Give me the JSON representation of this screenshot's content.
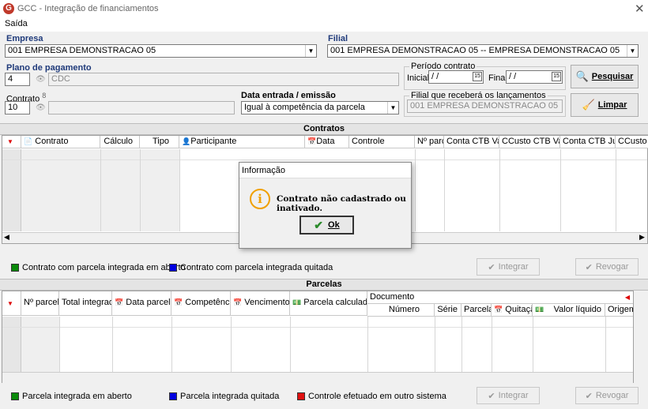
{
  "window": {
    "title": "GCC - Integração de financiamentos",
    "close_glyph": "✕",
    "logo_letter": "G"
  },
  "menu": {
    "items": [
      "Saída"
    ]
  },
  "empresa": {
    "label": "Empresa",
    "value": "001 EMPRESA DEMONSTRACAO 05"
  },
  "filial": {
    "label": "Filial",
    "value": "001 EMPRESA DEMONSTRACAO 05 -- EMPRESA DEMONSTRACAO 05"
  },
  "plano": {
    "label": "Plano de pagamento",
    "code": "4",
    "desc": "CDC"
  },
  "contrato": {
    "label": "Contrato",
    "label_suffix": "8",
    "code": "10",
    "desc": ""
  },
  "data_entrada": {
    "label": "Data entrada / emissão",
    "value": "Igual à competência da parcela"
  },
  "periodo": {
    "title": "Período contrato",
    "inicial_label": "Inicial",
    "inicial_value": "/ /",
    "final_label": "Final",
    "final_value": "/ /"
  },
  "filial_receb": {
    "title": "Filial que receberá os lançamentos",
    "value": "001 EMPRESA DEMONSTRACAO 05"
  },
  "buttons": {
    "pesquisar": "Pesquisar",
    "limpar": "Limpar"
  },
  "contratos": {
    "title": "Contratos",
    "columns": [
      "Contrato",
      "Cálculo",
      "Tipo",
      "Participante",
      "Data",
      "Controle",
      "Nº parc",
      "Conta CTB Valor",
      "CCusto CTB Valor",
      "Conta CTB Juros",
      "CCusto CT"
    ],
    "legend": [
      {
        "label": "Contrato com parcela integrada em aberto",
        "color": "#0a8a0a"
      },
      {
        "label": "Contrato com parcela integrada quitada",
        "color": "#0000e0"
      }
    ],
    "integrar": "Integrar",
    "revogar": "Revogar"
  },
  "parcelas": {
    "title": "Parcelas",
    "columns": [
      "Nº parcela",
      "Total integradas",
      "Data parcela",
      "Competência",
      "Vencimento",
      "Parcela calculada"
    ],
    "documento": {
      "title": "Documento",
      "columns": [
        "Número",
        "Série",
        "Parcela",
        "Quitação",
        "Valor líquido",
        "Origem"
      ]
    },
    "legend": [
      {
        "label": "Parcela integrada em aberto",
        "color": "#0a8a0a"
      },
      {
        "label": "Parcela integrada quitada",
        "color": "#0000e0"
      },
      {
        "label": "Controle efetuado em outro sistema",
        "color": "#e01010"
      }
    ],
    "integrar": "Integrar",
    "revogar": "Revogar"
  },
  "dialog": {
    "title": "Informação",
    "message": "Contrato não cadastrado ou inativado.",
    "ok": "Ok",
    "icon": "info-icon"
  }
}
